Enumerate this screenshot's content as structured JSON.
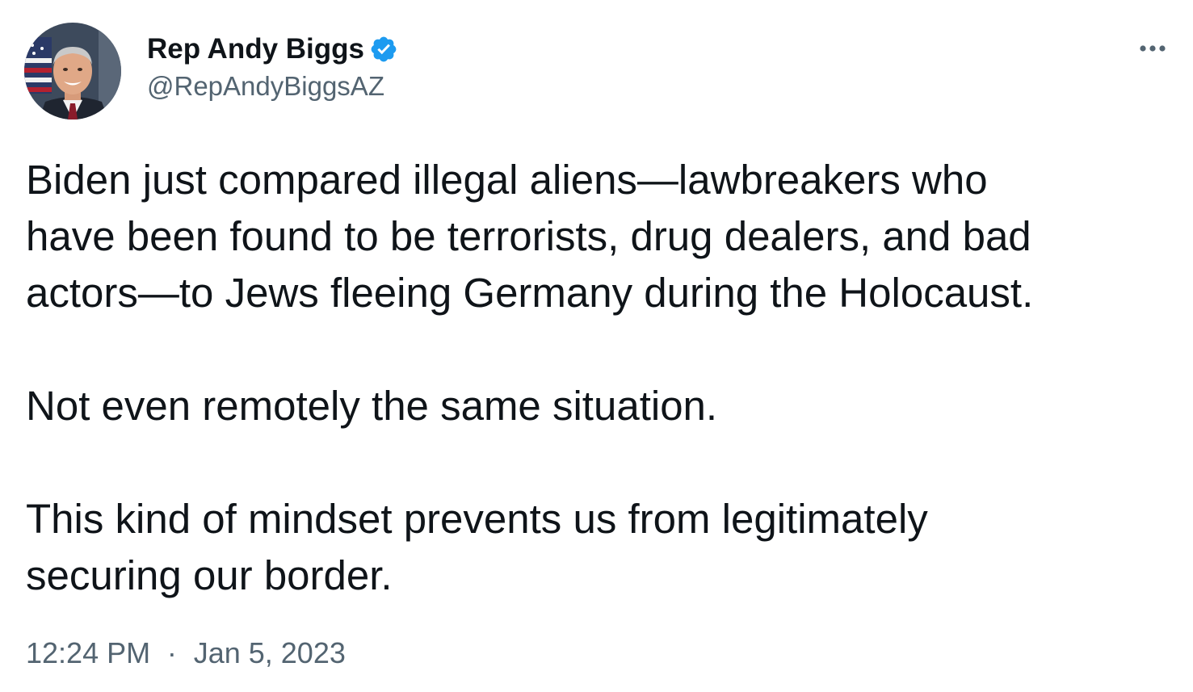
{
  "author": {
    "display_name": "Rep Andy Biggs",
    "handle": "@RepAndyBiggsAZ",
    "verified": true,
    "avatar_icon": "profile-photo"
  },
  "tweet": {
    "paragraphs": [
      {
        "lines": [
          "Biden just compared illegal aliens—lawbreakers who",
          "have been found to be terrorists, drug dealers, and bad",
          "actors—to Jews fleeing Germany during the Holocaust."
        ]
      },
      {
        "lines": [
          "Not even remotely the same situation."
        ]
      },
      {
        "lines": [
          "This kind of mindset prevents us from legitimately",
          "securing our border."
        ]
      }
    ],
    "time": "12:24 PM",
    "separator": "·",
    "date": "Jan 5, 2023"
  },
  "icons": {
    "verified_badge": "verified-badge-icon",
    "more": "more-options-icon"
  },
  "colors": {
    "text_primary": "#0f1419",
    "text_secondary": "#536471",
    "verified_blue": "#1d9bf0",
    "background": "#ffffff"
  }
}
